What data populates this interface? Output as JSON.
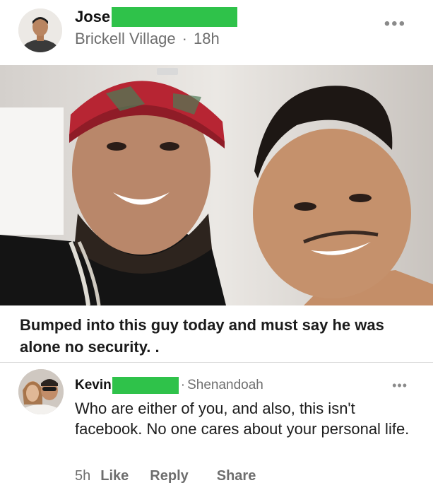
{
  "post": {
    "author_name": "Jose",
    "location": "Brickell Village",
    "separator": "·",
    "time": "18h",
    "more": "•••",
    "caption": "Bumped into this guy today and must say he was alone no security. ."
  },
  "comment": {
    "author_name": "Kevin",
    "location_prefix": "·",
    "location": "Shenandoah",
    "more": "•••",
    "text": "Who are either of you, and also, this isn't facebook. No one cares about your personal life.",
    "time": "5h",
    "like_label": "Like",
    "reply_label": "Reply",
    "share_label": "Share"
  },
  "colors": {
    "redaction": "#2fc24a",
    "meta_text": "#6e6e6e",
    "cap": "#b52532"
  }
}
